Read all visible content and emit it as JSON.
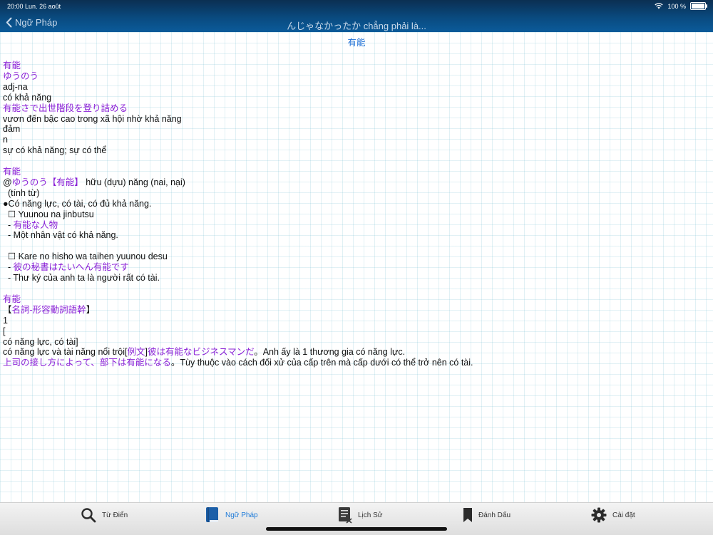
{
  "status": {
    "time": "20:00",
    "date": "Lun. 26 août",
    "battery": "100 %"
  },
  "nav": {
    "back_label": "Ngữ Pháp",
    "title": "んじゃなかったか chẳng phải là..."
  },
  "entry_heading": "有能",
  "lines": [
    {
      "t": "有能",
      "c": "p"
    },
    {
      "t": "ゆうのう",
      "c": "p"
    },
    {
      "t": "adj-na",
      "c": ""
    },
    {
      "t": "có khả năng",
      "c": ""
    },
    {
      "t": "有能さで出世階段を登り詰める",
      "c": "p"
    },
    {
      "t": "vươn đến bậc cao trong xã hội nhờ khả năng",
      "c": ""
    },
    {
      "t": "đảm",
      "c": ""
    },
    {
      "t": "n",
      "c": ""
    },
    {
      "t": "sự có khả năng; sự có thể",
      "c": ""
    },
    {
      "t": "",
      "c": ""
    },
    {
      "t": "有能",
      "c": "p"
    },
    {
      "segs": [
        {
          "t": "@",
          "c": ""
        },
        {
          "t": "ゆうのう【有能】",
          "c": "p"
        },
        {
          "t": " hữu (dựu) năng (nai, nại)",
          "c": ""
        }
      ]
    },
    {
      "t": "  (tính từ)",
      "c": ""
    },
    {
      "t": "●Có năng lực, có tài, có đủ khả năng.",
      "c": ""
    },
    {
      "t": "  ☐ Yuunou na jinbutsu",
      "c": ""
    },
    {
      "segs": [
        {
          "t": "  - ",
          "c": ""
        },
        {
          "t": "有能な人物",
          "c": "p"
        }
      ]
    },
    {
      "t": "  - Một nhân vật có khả năng.",
      "c": ""
    },
    {
      "t": "",
      "c": ""
    },
    {
      "t": "  ☐ Kare no hisho wa taihen yuunou desu",
      "c": ""
    },
    {
      "segs": [
        {
          "t": "  - ",
          "c": ""
        },
        {
          "t": "彼の秘書はたいへん有能です",
          "c": "p"
        }
      ]
    },
    {
      "t": "  - Thư ký của anh ta là người rất có tài.",
      "c": ""
    },
    {
      "t": "",
      "c": ""
    },
    {
      "t": "有能",
      "c": "p"
    },
    {
      "segs": [
        {
          "t": "【",
          "c": ""
        },
        {
          "t": "名詞-形容動詞語幹",
          "c": "p"
        },
        {
          "t": "】",
          "c": ""
        }
      ]
    },
    {
      "t": "1",
      "c": ""
    },
    {
      "t": "[",
      "c": ""
    },
    {
      "t": "có năng lực, có tài]",
      "c": ""
    },
    {
      "segs": [
        {
          "t": "có năng lực và tài năng nổi trội[",
          "c": ""
        },
        {
          "t": "例文",
          "c": "p"
        },
        {
          "t": "]",
          "c": ""
        },
        {
          "t": "彼は有能なビジネスマンだ",
          "c": "p"
        },
        {
          "t": "。Anh ấy là 1 thương gia có năng lực.",
          "c": ""
        }
      ]
    },
    {
      "segs": [
        {
          "t": "上司の接し方によって、部下は有能になる",
          "c": "p"
        },
        {
          "t": "。Tùy thuộc vào cách đối xử của cấp trên mà cấp dưới có thể trở nên có tài.",
          "c": ""
        }
      ]
    }
  ],
  "tabs": [
    {
      "label": "Từ Điển",
      "icon": "search-icon"
    },
    {
      "label": "Ngữ Pháp",
      "icon": "book-icon",
      "active": true
    },
    {
      "label": "Lịch Sử",
      "icon": "history-icon"
    },
    {
      "label": "Đánh Dấu",
      "icon": "bookmark-icon"
    },
    {
      "label": "Cài đặt",
      "icon": "gear-icon"
    }
  ],
  "colors": {
    "accent": "#1c7ad8",
    "purple": "#8a1fd6",
    "nav_bg": "#0a4a7f"
  }
}
